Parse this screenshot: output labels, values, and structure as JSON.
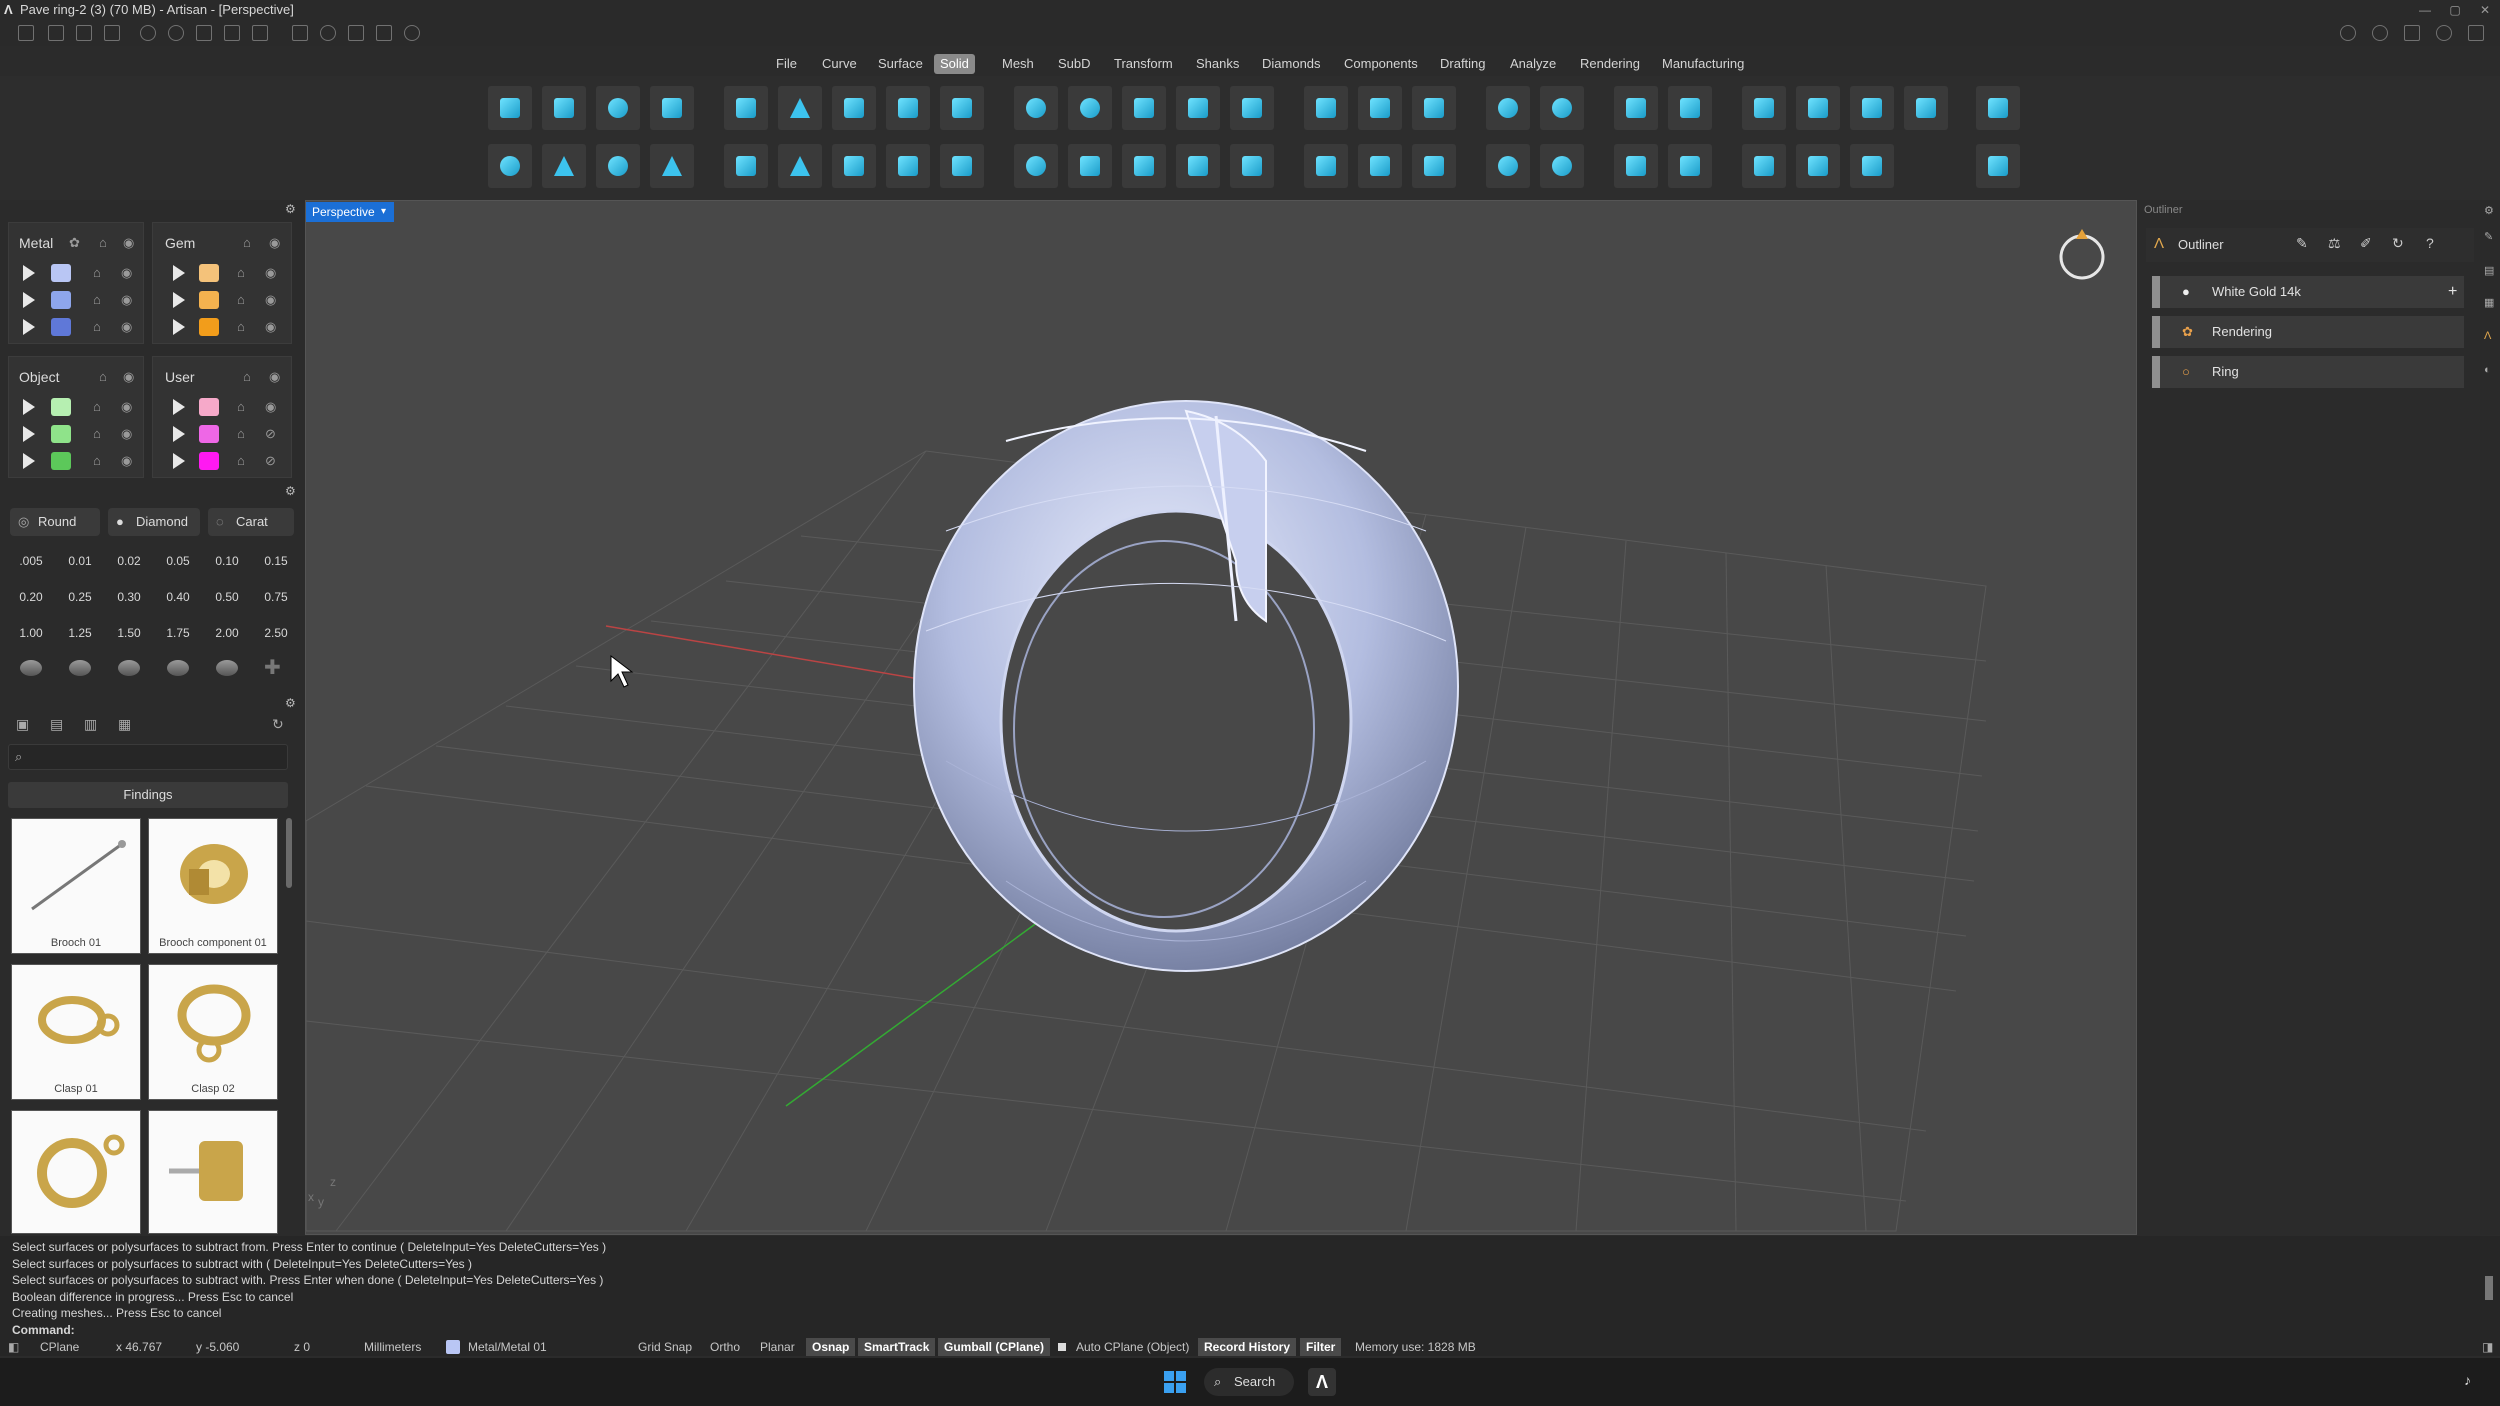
{
  "window": {
    "title": "Pave ring-2 (3) (70 MB) - Artisan - [Perspective]"
  },
  "menu": {
    "items": [
      "File",
      "Curve",
      "Surface",
      "Solid",
      "Mesh",
      "SubD",
      "Transform",
      "Shanks",
      "Diamonds",
      "Components",
      "Drafting",
      "Analyze",
      "Rendering",
      "Manufacturing"
    ],
    "active": "Solid"
  },
  "layers": {
    "metal_title": "Metal",
    "gem_title": "Gem",
    "object_title": "Object",
    "user_title": "User",
    "metal_colors": [
      "#b9c6f4",
      "#8ea6ec",
      "#5f78d8"
    ],
    "gem_colors": [
      "#f4c27a",
      "#f4b24f",
      "#f29d1b"
    ],
    "object_colors": [
      "#b6efb1",
      "#8fe38a",
      "#5cc85a"
    ],
    "user_colors": [
      "#f6a9c9",
      "#ee67e6",
      "#ff19f2"
    ]
  },
  "gems": {
    "shape_label": "Round",
    "type_label": "Diamond",
    "unit_label": "Carat",
    "sizes": [
      ".005",
      "0.01",
      "0.02",
      "0.05",
      "0.10",
      "0.15",
      "0.20",
      "0.25",
      "0.30",
      "0.40",
      "0.50",
      "0.75",
      "1.00",
      "1.25",
      "1.50",
      "1.75",
      "2.00",
      "2.50"
    ]
  },
  "library": {
    "search_placeholder": "",
    "category": "Findings",
    "items": [
      "Brooch 01",
      "Brooch component 01",
      "Clasp 01",
      "Clasp 02",
      "",
      ""
    ]
  },
  "viewport": {
    "label": "Perspective",
    "axis_x": "x",
    "axis_y": "y",
    "axis_z": "z"
  },
  "outliner": {
    "panel_title": "Outliner",
    "header": "Outliner",
    "items": [
      "White Gold 14k",
      "Rendering",
      "Ring"
    ]
  },
  "command": {
    "history": [
      "Select surfaces or polysurfaces to subtract from. Press Enter to continue ( DeleteInput=Yes  DeleteCutters=Yes )",
      "Select surfaces or polysurfaces to subtract with ( DeleteInput=Yes  DeleteCutters=Yes )",
      "Select surfaces or polysurfaces to subtract with. Press Enter when done ( DeleteInput=Yes  DeleteCutters=Yes )",
      "Boolean difference in progress... Press Esc to cancel",
      "Creating meshes... Press Esc to cancel"
    ],
    "prompt": "Command:"
  },
  "status": {
    "cplane": "CPlane",
    "x": "x 46.767",
    "y": "y -5.060",
    "z": "z 0",
    "units": "Millimeters",
    "layer": "Metal/Metal 01",
    "grid_snap": "Grid Snap",
    "ortho": "Ortho",
    "planar": "Planar",
    "osnap": "Osnap",
    "smarttrack": "SmartTrack",
    "gumball": "Gumball (CPlane)",
    "auto_cplane": "Auto CPlane (Object)",
    "record_history": "Record History",
    "filter": "Filter",
    "memory": "Memory use: 1828 MB"
  },
  "taskbar": {
    "search": "Search"
  }
}
